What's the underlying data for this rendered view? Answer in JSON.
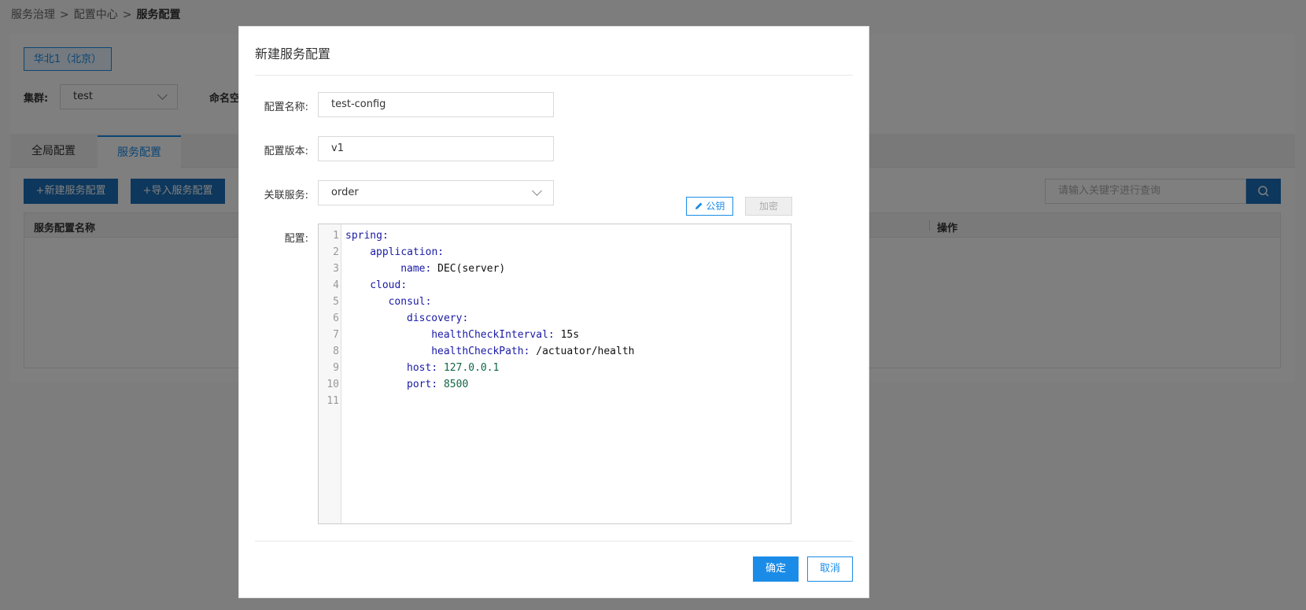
{
  "breadcrumb": [
    "服务治理",
    "配置中心",
    "服务配置"
  ],
  "breadcrumb_sep": ">",
  "region": "华北1（北京）",
  "filters": {
    "cluster_label": "集群:",
    "cluster_value": "test",
    "namespace_label_partial": "命名空"
  },
  "tabs": [
    {
      "label": "全局配置",
      "active": false
    },
    {
      "label": "服务配置",
      "active": true
    }
  ],
  "toolbar": {
    "new_button": "新建服务配置",
    "import_button": "导入服务配置",
    "search_placeholder": "请输入关键字进行查询"
  },
  "table": {
    "columns": [
      "服务配置名称",
      "操作"
    ]
  },
  "modal": {
    "title": "新建服务配置",
    "fields": {
      "name_label": "配置名称:",
      "name_value": "test-config",
      "version_label": "配置版本:",
      "version_value": "v1",
      "service_label": "关联服务:",
      "service_value": "order",
      "config_label": "配置:"
    },
    "key_button": "公钥",
    "encrypt_button": "加密",
    "code_lines": [
      {
        "num": "1",
        "indent": 0,
        "key": "spring",
        "value": "",
        "vtype": "v"
      },
      {
        "num": "2",
        "indent": 4,
        "key": "application",
        "value": "",
        "vtype": "v"
      },
      {
        "num": "3",
        "indent": 9,
        "key": "name",
        "value": "DEC(server)",
        "vtype": "v"
      },
      {
        "num": "4",
        "indent": 4,
        "key": "cloud",
        "value": "",
        "vtype": "v"
      },
      {
        "num": "5",
        "indent": 7,
        "key": "consul",
        "value": "",
        "vtype": "v"
      },
      {
        "num": "6",
        "indent": 10,
        "key": "discovery",
        "value": "",
        "vtype": "v"
      },
      {
        "num": "7",
        "indent": 14,
        "key": "healthCheckInterval",
        "value": "15s",
        "vtype": "v"
      },
      {
        "num": "8",
        "indent": 14,
        "key": "healthCheckPath",
        "value": "/actuator/health",
        "vtype": "v"
      },
      {
        "num": "9",
        "indent": 10,
        "key": "host",
        "value": "127.0.0.1",
        "vtype": "n"
      },
      {
        "num": "10",
        "indent": 10,
        "key": "port",
        "value": "8500",
        "vtype": "n"
      },
      {
        "num": "11",
        "indent": 0,
        "key": "",
        "value": "",
        "vtype": "v"
      }
    ],
    "ok_button": "确定",
    "cancel_button": "取消"
  },
  "colors": {
    "primary": "#1a8ce8",
    "overlay": "rgba(0,0,0,0.5)"
  }
}
